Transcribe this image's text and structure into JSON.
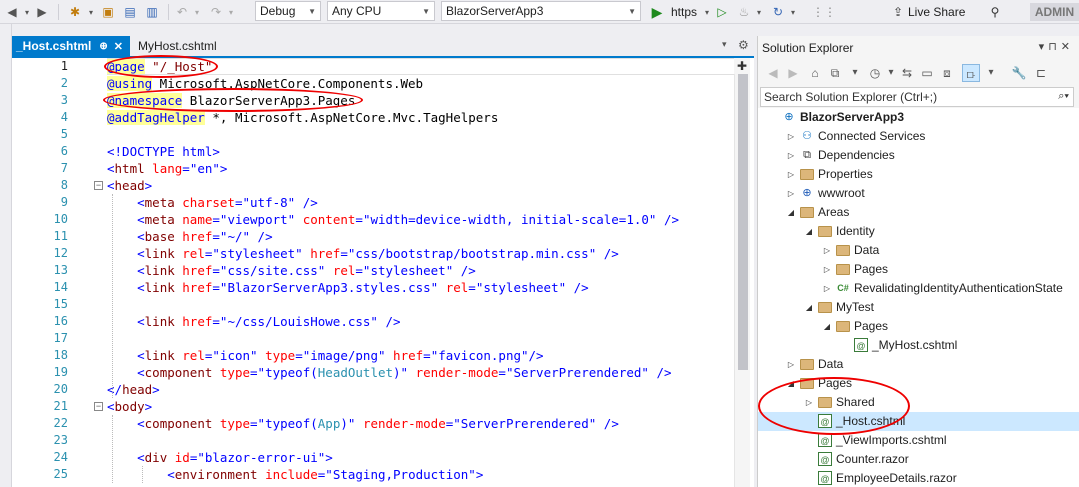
{
  "toolbar": {
    "config": "Debug",
    "platform": "Any CPU",
    "startup_project": "BlazorServerApp3",
    "run_profile": "https",
    "live_share": "Live Share",
    "user": "ADMIN"
  },
  "tabs": [
    {
      "label": "_Host.cshtml",
      "pin": "⊕",
      "close": "✕"
    },
    {
      "label": "MyHost.cshtml"
    }
  ],
  "editor": {
    "lines": [
      {
        "n": "1"
      },
      {
        "n": "2"
      },
      {
        "n": "3"
      },
      {
        "n": "4"
      },
      {
        "n": "5"
      },
      {
        "n": "6"
      },
      {
        "n": "7"
      },
      {
        "n": "8"
      },
      {
        "n": "9"
      },
      {
        "n": "10"
      },
      {
        "n": "11"
      },
      {
        "n": "12"
      },
      {
        "n": "13"
      },
      {
        "n": "14"
      },
      {
        "n": "15"
      },
      {
        "n": "16"
      },
      {
        "n": "17"
      },
      {
        "n": "18"
      },
      {
        "n": "19"
      },
      {
        "n": "20"
      },
      {
        "n": "21"
      },
      {
        "n": "22"
      },
      {
        "n": "23"
      },
      {
        "n": "24"
      },
      {
        "n": "25"
      }
    ],
    "code": {
      "l1": [
        "@page",
        " ",
        "\"/_Host\""
      ],
      "l2": [
        "@using",
        " Microsoft.AspNetCore.Components.Web"
      ],
      "l3": [
        "@namespace",
        " BlazorServerApp3.Pages"
      ],
      "l4": [
        "@addTagHelper",
        " *, Microsoft.AspNetCore.Mvc.TagHelpers"
      ],
      "l6": [
        "<!DOCTYPE html>"
      ],
      "l7": [
        "<",
        "html",
        " ",
        "lang",
        "=",
        "\"en\"",
        ">"
      ],
      "l8": [
        "<",
        "head",
        ">"
      ],
      "l9": [
        "<",
        "meta",
        " ",
        "charset",
        "=",
        "\"utf-8\"",
        " />"
      ],
      "l10": [
        "<",
        "meta",
        " ",
        "name",
        "=",
        "\"viewport\"",
        " ",
        "content",
        "=",
        "\"width=device-width, initial-scale=1.0\"",
        " />"
      ],
      "l11": [
        "<",
        "base",
        " ",
        "href",
        "=",
        "\"~/\"",
        " />"
      ],
      "l12": [
        "<",
        "link",
        " ",
        "rel",
        "=",
        "\"stylesheet\"",
        " ",
        "href",
        "=",
        "\"css/bootstrap/bootstrap.min.css\"",
        " />"
      ],
      "l13": [
        "<",
        "link",
        " ",
        "href",
        "=",
        "\"css/site.css\"",
        " ",
        "rel",
        "=",
        "\"stylesheet\"",
        " />"
      ],
      "l14": [
        "<",
        "link",
        " ",
        "href",
        "=",
        "\"BlazorServerApp3.styles.css\"",
        " ",
        "rel",
        "=",
        "\"stylesheet\"",
        " />"
      ],
      "l16": [
        "<",
        "link",
        " ",
        "href",
        "=",
        "\"~/css/LouisHowe.css\"",
        " />"
      ],
      "l18": [
        "<",
        "link",
        " ",
        "rel",
        "=",
        "\"icon\"",
        " ",
        "type",
        "=",
        "\"image/png\"",
        " ",
        "href",
        "=",
        "\"favicon.png\"",
        "/>"
      ],
      "l19": [
        "<",
        "component",
        " ",
        "type",
        "=",
        "\"typeof(",
        "HeadOutlet",
        ")\"",
        " ",
        "render-mode",
        "=",
        "\"ServerPrerendered\"",
        " />"
      ],
      "l20": [
        "</",
        "head",
        ">"
      ],
      "l21": [
        "<",
        "body",
        ">"
      ],
      "l22": [
        "<",
        "component",
        " ",
        "type",
        "=",
        "\"typeof(",
        "App",
        ")\"",
        " ",
        "render-mode",
        "=",
        "\"ServerPrerendered\"",
        " />"
      ],
      "l24": [
        "<",
        "div",
        " ",
        "id",
        "=",
        "\"blazor-error-ui\"",
        ">"
      ],
      "l25": [
        "<",
        "environment",
        " ",
        "include",
        "=",
        "\"Staging,Production\"",
        ">"
      ]
    }
  },
  "solution_explorer": {
    "title": "Solution Explorer",
    "search_placeholder": "Search Solution Explorer (Ctrl+;)",
    "tree": [
      {
        "label": "BlazorServerApp3",
        "indent": 0,
        "icon": "project-icon",
        "expand": ""
      },
      {
        "label": "Connected Services",
        "indent": 1,
        "icon": "connected-services-icon",
        "expand": "▷"
      },
      {
        "label": "Dependencies",
        "indent": 1,
        "icon": "dependencies-icon",
        "expand": "▷"
      },
      {
        "label": "Properties",
        "indent": 1,
        "icon": "folder-icon",
        "expand": "▷"
      },
      {
        "label": "wwwroot",
        "indent": 1,
        "icon": "globe-icon",
        "expand": "▷"
      },
      {
        "label": "Areas",
        "indent": 1,
        "icon": "folder-icon",
        "expand": "◢"
      },
      {
        "label": "Identity",
        "indent": 2,
        "icon": "folder-icon",
        "expand": "◢"
      },
      {
        "label": "Data",
        "indent": 3,
        "icon": "folder-icon",
        "expand": "▷"
      },
      {
        "label": "Pages",
        "indent": 3,
        "icon": "folder-icon",
        "expand": "▷"
      },
      {
        "label": "RevalidatingIdentityAuthenticationState",
        "indent": 3,
        "icon": "csharp-icon",
        "expand": "▷"
      },
      {
        "label": "MyTest",
        "indent": 2,
        "icon": "folder-icon",
        "expand": "◢"
      },
      {
        "label": "Pages",
        "indent": 3,
        "icon": "folder-icon",
        "expand": "◢"
      },
      {
        "label": "_MyHost.cshtml",
        "indent": 4,
        "icon": "razor-page-icon",
        "expand": ""
      },
      {
        "label": "Data",
        "indent": 1,
        "icon": "folder-icon",
        "expand": "▷"
      },
      {
        "label": "Pages",
        "indent": 1,
        "icon": "folder-icon",
        "expand": "◢"
      },
      {
        "label": "Shared",
        "indent": 2,
        "icon": "folder-icon",
        "expand": "▷"
      },
      {
        "label": "_Host.cshtml",
        "indent": 2,
        "icon": "razor-page-icon",
        "expand": "",
        "selected": true
      },
      {
        "label": "_ViewImports.cshtml",
        "indent": 2,
        "icon": "razor-page-icon",
        "expand": ""
      },
      {
        "label": "Counter.razor",
        "indent": 2,
        "icon": "razor-page-icon",
        "expand": ""
      },
      {
        "label": "EmployeeDetails.razor",
        "indent": 2,
        "icon": "razor-page-icon",
        "expand": ""
      }
    ]
  },
  "colors": {
    "accent": "#007acc",
    "annotation": "#e00000",
    "selection": "#cce8ff"
  }
}
